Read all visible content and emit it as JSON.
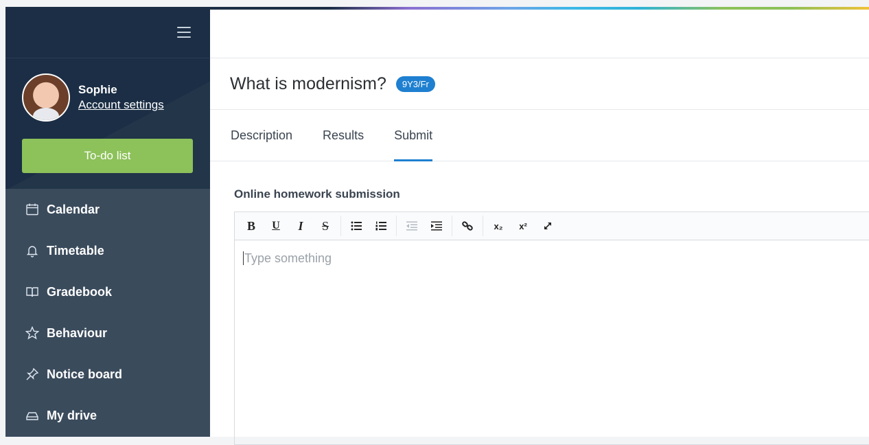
{
  "sidebar": {
    "user": {
      "name": "Sophie",
      "account_link": "Account settings"
    },
    "todo_label": "To-do list",
    "items": [
      {
        "label": "Calendar",
        "icon": "calendar-icon"
      },
      {
        "label": "Timetable",
        "icon": "bell-icon"
      },
      {
        "label": "Gradebook",
        "icon": "book-icon"
      },
      {
        "label": "Behaviour",
        "icon": "star-icon"
      },
      {
        "label": "Notice board",
        "icon": "pin-icon"
      },
      {
        "label": "My drive",
        "icon": "drive-icon"
      }
    ]
  },
  "main": {
    "title": "What is modernism?",
    "class_badge": "9Y3/Fr",
    "tabs": [
      {
        "label": "Description",
        "active": false
      },
      {
        "label": "Results",
        "active": false
      },
      {
        "label": "Submit",
        "active": true
      }
    ],
    "section_label": "Online homework submission",
    "editor": {
      "placeholder": "Type something",
      "toolbar": {
        "bold": "B",
        "underline": "U",
        "italic": "I",
        "strike": "S",
        "subscript": "x₂",
        "superscript": "x²"
      }
    }
  },
  "colors": {
    "sidebar_dark": "#1b2e45",
    "sidebar": "#3a4b5c",
    "todo_green": "#8dc15a",
    "accent_blue": "#1f7fd0"
  }
}
